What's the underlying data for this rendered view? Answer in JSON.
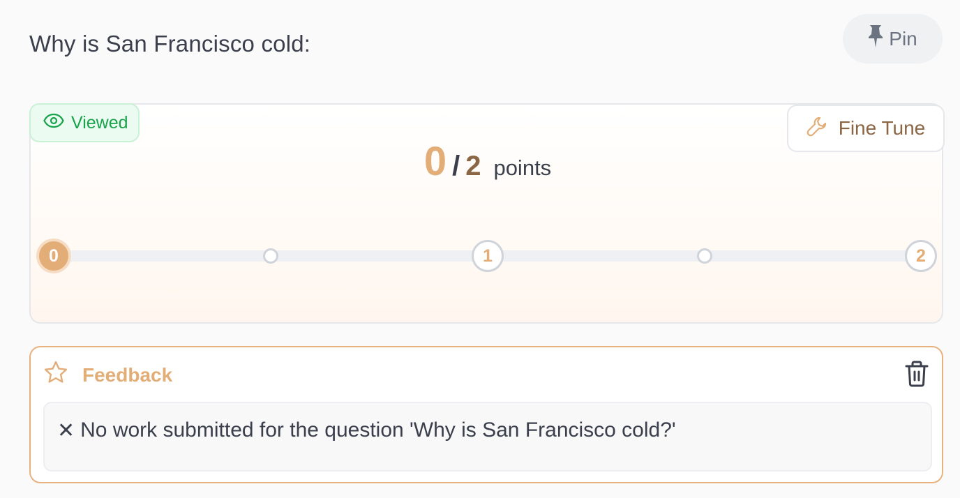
{
  "header": {
    "title": "Why is San Francisco cold:",
    "pin_label": "Pin"
  },
  "score_card": {
    "viewed_label": "Viewed",
    "fine_tune_label": "Fine Tune",
    "score": "0",
    "slash": "/",
    "max": "2",
    "unit": "points",
    "scale": {
      "selected": "0",
      "stops": [
        "0",
        "",
        "1",
        "",
        "2"
      ]
    }
  },
  "feedback": {
    "label": "Feedback",
    "mark": "✕",
    "text": "No work submitted for the question 'Why is San Francisco cold?'"
  },
  "colors": {
    "accent": "#e2ad77",
    "brown": "#8b6645",
    "viewed_green": "#17a34a"
  }
}
